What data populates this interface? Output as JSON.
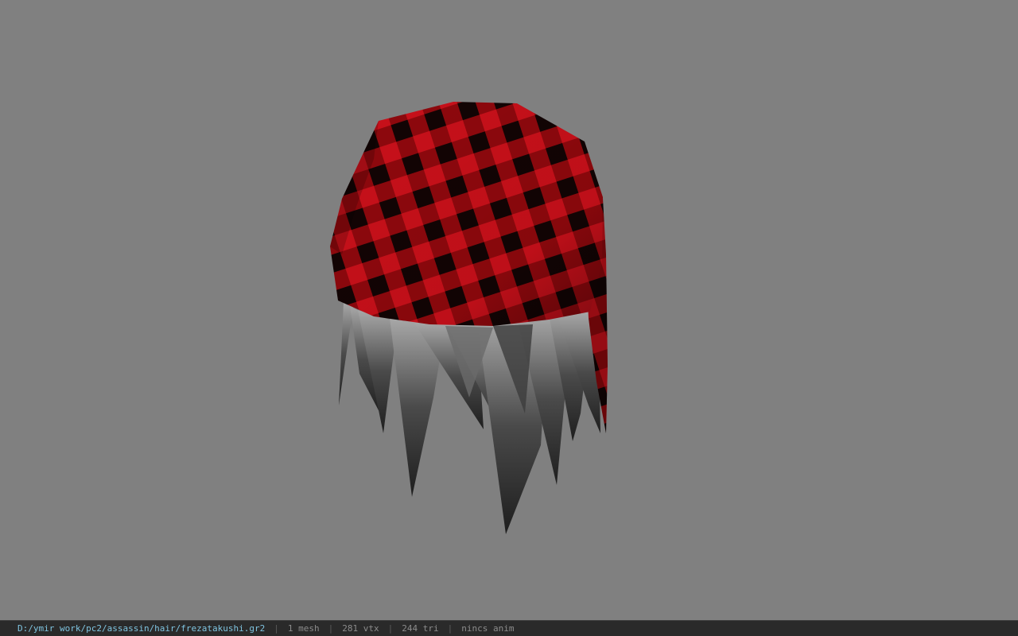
{
  "viewport": {
    "background": "#808080",
    "model": {
      "cap_colors": {
        "red": "#c8101a",
        "dark": "#120404"
      },
      "hair_color": "#5a5a5a"
    }
  },
  "status_bar": {
    "file_path": "D:/ymir work/pc2/assassin/hair/frezatakushi.gr2",
    "separator": "|",
    "mesh_count": "1 mesh",
    "vertex_count": "281 vtx",
    "triangle_count": "244 tri",
    "anim_status": "nincs anim"
  }
}
